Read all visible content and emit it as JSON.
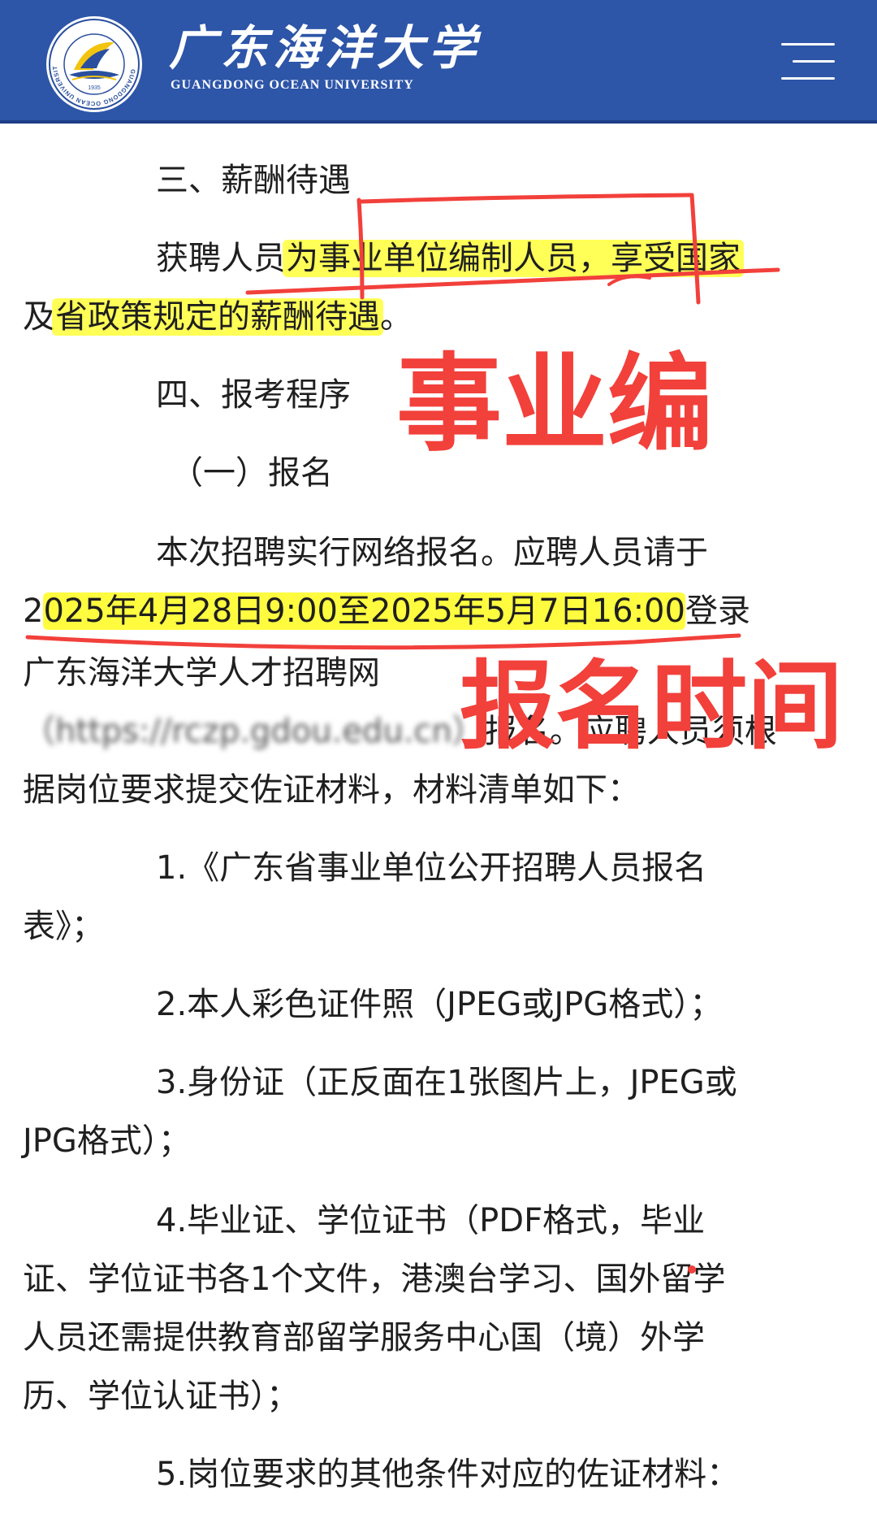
{
  "header": {
    "brand_cn": "广东海洋大学",
    "brand_en": "GUANGDONG OCEAN UNIVERSITY",
    "logo_ring_text": "GUANGDONG OCEAN UNIVERSITY",
    "logo_year": "1935",
    "menu_icon": "hamburger-icon",
    "colors": {
      "bar": "#2d55a8",
      "logo_yellow": "#f2c40f",
      "logo_blue": "#2a4f9e"
    }
  },
  "article": {
    "s3_heading": "三、薪酬待遇",
    "s3_p1_a": "获聘人员",
    "s3_p1_hl": "为事业单位编制人员，享受国家",
    "s3_p2_a": "及",
    "s3_p2_hl": "省政策规定的薪酬待遇",
    "s3_p2_b": "。",
    "s4_heading": "四、报考程序",
    "s4_sub1": "（一）报名",
    "reg_p1": "本次招聘实行网络报名。应聘人员请于",
    "reg_p2_a": "2",
    "reg_p2_hl": "025年4月28日9:00至2025年5月7日16:00",
    "reg_p2_b": "登录",
    "reg_p3": "广东海洋大学人才招聘网",
    "reg_p4_url": "（https://rczp.gdou.edu.cn）",
    "reg_p4_b": "报名。应聘人员须根",
    "reg_p5": "据岗位要求提交佐证材料，材料清单如下：",
    "item1_a": "1.《广东省事业单位公开招聘人员报名",
    "item1_b": "表》；",
    "item2": "2.本人彩色证件照（JPEG或JPG格式）；",
    "item3_a": "3.身份证（正反面在1张图片上，JPEG或",
    "item3_b": "JPG格式）；",
    "item4_a": "4.毕业证、学位证书（PDF格式，毕业",
    "item4_b": "证、学位证书各1个文件，港澳台学习、国外留学",
    "item4_c": "人员还需提供教育部留学服务中心国（境）外学",
    "item4_d": "历、学位认证书）；",
    "item5": "5.岗位要求的其他条件对应的佐证材料："
  },
  "annotations": {
    "label_1": "事业编",
    "label_2": "报名时间",
    "color": "#f2403b",
    "highlight_color": "#ffff28"
  }
}
